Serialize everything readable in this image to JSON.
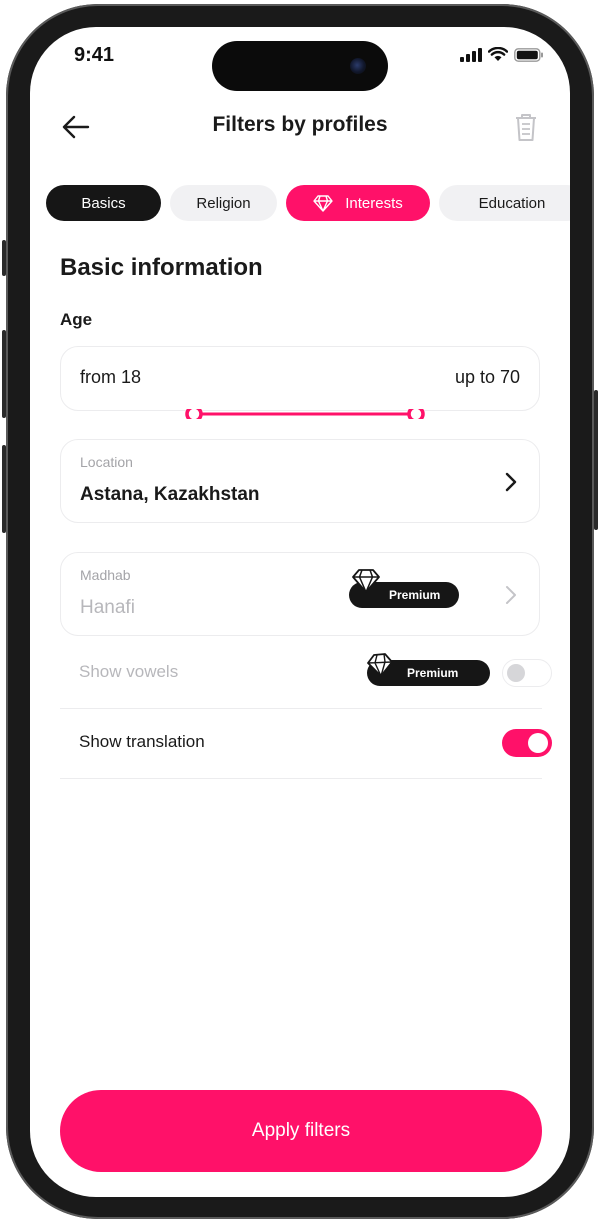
{
  "status_bar": {
    "time": "9:41"
  },
  "header": {
    "title": "Filters by profiles"
  },
  "tabs": [
    {
      "label": "Basics",
      "state": "selected"
    },
    {
      "label": "Religion",
      "state": "default"
    },
    {
      "label": "Interests",
      "state": "premium-highlight",
      "icon": "diamond-icon"
    },
    {
      "label": "Education",
      "state": "default"
    }
  ],
  "section": {
    "title": "Basic information"
  },
  "age": {
    "label": "Age",
    "from_text": "from 18",
    "to_text": "up to 70",
    "min": 18,
    "max": 70
  },
  "location": {
    "label": "Location",
    "value": "Astana, Kazakhstan"
  },
  "madhab": {
    "label": "Madhab",
    "value": "Hanafi",
    "badge": "Premium"
  },
  "show_vowels": {
    "label": "Show vowels",
    "badge": "Premium",
    "enabled": false
  },
  "show_translation": {
    "label": "Show translation",
    "enabled": true
  },
  "apply_button": {
    "label": "Apply filters"
  },
  "colors": {
    "accent": "#ff1169",
    "dark": "#161616",
    "muted_text": "#b7b7bb"
  }
}
